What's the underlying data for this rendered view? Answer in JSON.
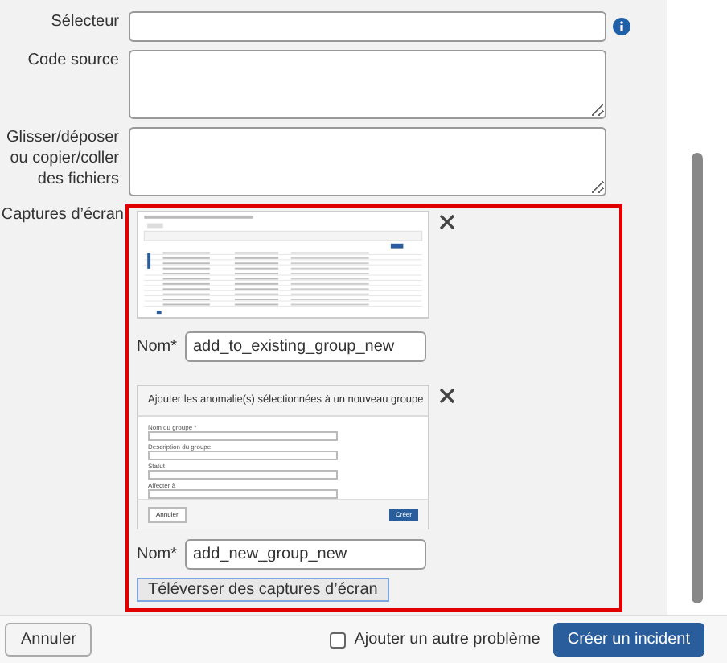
{
  "fields": [
    {
      "kind": "input",
      "label": "Sélecteur",
      "info": true
    },
    {
      "kind": "textarea",
      "label": "Code source",
      "info": false
    },
    {
      "kind": "textarea",
      "label": "Glisser/déposer ou copier/coller des fichiers",
      "info": false
    }
  ],
  "screenshots": {
    "label": "Captures d’écran",
    "items": [
      {
        "kind": "table",
        "name_label": "Nom*",
        "name_value": "add_to_existing_group_new"
      },
      {
        "kind": "dialog",
        "title": "Ajouter les anomalie(s) sélectionnées à un nouveau groupe",
        "fields": [
          "Nom du groupe *",
          "Description du groupe",
          "Statut",
          "Affecter à"
        ],
        "cancel": "Annuler",
        "ok": "Créer",
        "name_label": "Nom*",
        "name_value": "add_new_group_new"
      }
    ],
    "upload_button": "Téléverser des captures d’écran"
  },
  "footer": {
    "cancel": "Annuler",
    "another": {
      "label": "Ajouter un autre problème",
      "checked": false
    },
    "submit": "Créer un incident"
  }
}
